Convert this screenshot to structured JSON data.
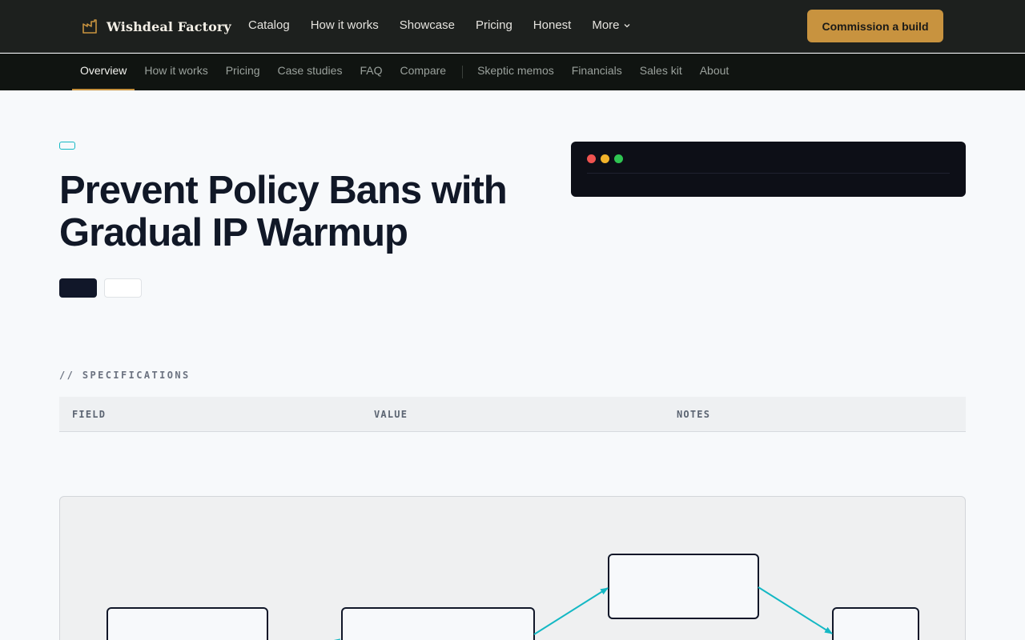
{
  "brand": {
    "name": "Wishdeal Factory",
    "icon": "factory-icon",
    "accent": "#c8933f"
  },
  "main_nav": {
    "items": [
      "Catalog",
      "How it works",
      "Showcase",
      "Pricing",
      "Honest"
    ],
    "more_label": "More"
  },
  "cta": {
    "label": "Commission a build"
  },
  "sub_nav": {
    "primary": [
      "Overview",
      "How it works",
      "Pricing",
      "Case studies",
      "FAQ",
      "Compare"
    ],
    "secondary": [
      "Skeptic memos",
      "Financials",
      "Sales kit",
      "About"
    ],
    "active": "Overview"
  },
  "hero": {
    "title": "Prevent Policy Bans with Gradual IP Warmup"
  },
  "terminal": {
    "window_dots": [
      "#ef5350",
      "#f2b32a",
      "#2fc552"
    ]
  },
  "specifications": {
    "label": "// SPECIFICATIONS",
    "columns": [
      "FIELD",
      "VALUE",
      "NOTES"
    ]
  },
  "colors": {
    "header_bg": "#1d201e",
    "subnav_bg": "#101411",
    "accent_teal": "#14b8c4",
    "ink": "#111827"
  }
}
